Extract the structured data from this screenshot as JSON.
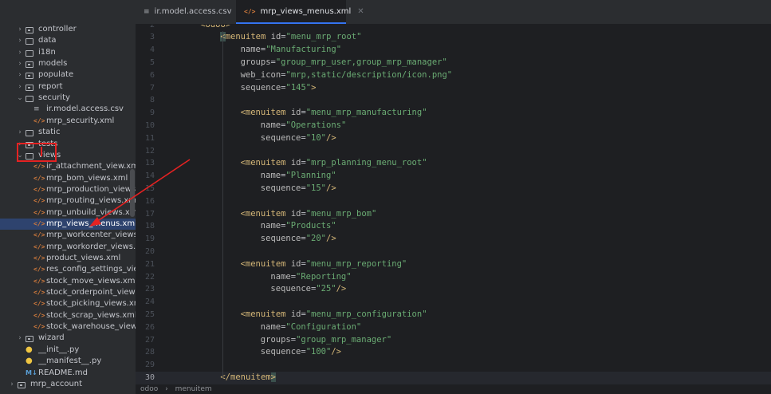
{
  "tabs": [
    {
      "label": "ir.model.access.csv",
      "icon": "csv-file-icon",
      "active": false
    },
    {
      "label": "mrp_views_menus.xml",
      "icon": "xml-file-icon",
      "active": true
    }
  ],
  "tree": [
    {
      "label": "controller",
      "type": "pkg",
      "depth": 1,
      "expanded": false
    },
    {
      "label": "data",
      "type": "folder",
      "depth": 1,
      "expanded": false
    },
    {
      "label": "i18n",
      "type": "folder",
      "depth": 1,
      "expanded": false
    },
    {
      "label": "models",
      "type": "pkg",
      "depth": 1,
      "expanded": false
    },
    {
      "label": "populate",
      "type": "pkg",
      "depth": 1,
      "expanded": false
    },
    {
      "label": "report",
      "type": "pkg",
      "depth": 1,
      "expanded": false
    },
    {
      "label": "security",
      "type": "folder",
      "depth": 1,
      "expanded": true
    },
    {
      "label": "ir.model.access.csv",
      "type": "csv",
      "depth": 2
    },
    {
      "label": "mrp_security.xml",
      "type": "xml",
      "depth": 2
    },
    {
      "label": "static",
      "type": "folder",
      "depth": 1,
      "expanded": false
    },
    {
      "label": "tests",
      "type": "pkg",
      "depth": 1,
      "expanded": false
    },
    {
      "label": "views",
      "type": "folder",
      "depth": 1,
      "expanded": true
    },
    {
      "label": "ir_attachment_view.xml",
      "type": "xml",
      "depth": 2
    },
    {
      "label": "mrp_bom_views.xml",
      "type": "xml",
      "depth": 2
    },
    {
      "label": "mrp_production_views.xml",
      "type": "xml",
      "depth": 2
    },
    {
      "label": "mrp_routing_views.xml",
      "type": "xml",
      "depth": 2
    },
    {
      "label": "mrp_unbuild_views.xml",
      "type": "xml",
      "depth": 2
    },
    {
      "label": "mrp_views_menus.xml",
      "type": "xml",
      "depth": 2,
      "selected": true
    },
    {
      "label": "mrp_workcenter_views.xml",
      "type": "xml",
      "depth": 2
    },
    {
      "label": "mrp_workorder_views.xml",
      "type": "xml",
      "depth": 2
    },
    {
      "label": "product_views.xml",
      "type": "xml",
      "depth": 2
    },
    {
      "label": "res_config_settings_views.xml",
      "type": "xml",
      "depth": 2
    },
    {
      "label": "stock_move_views.xml",
      "type": "xml",
      "depth": 2
    },
    {
      "label": "stock_orderpoint_views.xml",
      "type": "xml",
      "depth": 2
    },
    {
      "label": "stock_picking_views.xml",
      "type": "xml",
      "depth": 2
    },
    {
      "label": "stock_scrap_views.xml",
      "type": "xml",
      "depth": 2
    },
    {
      "label": "stock_warehouse_views.xml",
      "type": "xml",
      "depth": 2
    },
    {
      "label": "wizard",
      "type": "pkg",
      "depth": 1,
      "expanded": false
    },
    {
      "label": "__init__.py",
      "type": "py",
      "depth": 1
    },
    {
      "label": "__manifest__.py",
      "type": "py",
      "depth": 1
    },
    {
      "label": "README.md",
      "type": "md",
      "depth": 1
    },
    {
      "label": "mrp_account",
      "type": "pkg",
      "depth": 0,
      "expanded": false
    }
  ],
  "editor": {
    "current_line": 30,
    "lines": [
      {
        "n": 2,
        "tokens": [
          [
            "tag",
            "<odoo>"
          ]
        ],
        "indent": 4
      },
      {
        "n": 3,
        "tokens": [
          [
            "tag-hl",
            "<"
          ],
          [
            "tag",
            "menuitem "
          ],
          [
            "attr",
            "id"
          ],
          [
            "eq",
            "="
          ],
          [
            "str",
            "\"menu_mrp_root\""
          ]
        ],
        "indent": 8
      },
      {
        "n": 4,
        "tokens": [
          [
            "attr",
            "name"
          ],
          [
            "eq",
            "="
          ],
          [
            "str",
            "\"Manufacturing\""
          ]
        ],
        "indent": 12
      },
      {
        "n": 5,
        "tokens": [
          [
            "attr",
            "groups"
          ],
          [
            "eq",
            "="
          ],
          [
            "str",
            "\"group_mrp_user,group_mrp_manager\""
          ]
        ],
        "indent": 12
      },
      {
        "n": 6,
        "tokens": [
          [
            "attr",
            "web_icon"
          ],
          [
            "eq",
            "="
          ],
          [
            "str",
            "\"mrp,static/description/icon.png\""
          ]
        ],
        "indent": 12
      },
      {
        "n": 7,
        "tokens": [
          [
            "attr",
            "sequence"
          ],
          [
            "eq",
            "="
          ],
          [
            "str",
            "\"145\""
          ],
          [
            "punct",
            ">"
          ]
        ],
        "indent": 12
      },
      {
        "n": 8,
        "tokens": [],
        "indent": 0
      },
      {
        "n": 9,
        "tokens": [
          [
            "tag",
            "<menuitem "
          ],
          [
            "attr",
            "id"
          ],
          [
            "eq",
            "="
          ],
          [
            "str",
            "\"menu_mrp_manufacturing\""
          ]
        ],
        "indent": 12
      },
      {
        "n": 10,
        "tokens": [
          [
            "attr",
            "name"
          ],
          [
            "eq",
            "="
          ],
          [
            "str",
            "\"Operations\""
          ]
        ],
        "indent": 16
      },
      {
        "n": 11,
        "tokens": [
          [
            "attr",
            "sequence"
          ],
          [
            "eq",
            "="
          ],
          [
            "str",
            "\"10\""
          ],
          [
            "punct",
            "/>"
          ]
        ],
        "indent": 16
      },
      {
        "n": 12,
        "tokens": [],
        "indent": 0
      },
      {
        "n": 13,
        "tokens": [
          [
            "tag",
            "<menuitem "
          ],
          [
            "attr",
            "id"
          ],
          [
            "eq",
            "="
          ],
          [
            "str",
            "\"mrp_planning_menu_root\""
          ]
        ],
        "indent": 12
      },
      {
        "n": 14,
        "tokens": [
          [
            "attr",
            "name"
          ],
          [
            "eq",
            "="
          ],
          [
            "str",
            "\"Planning\""
          ]
        ],
        "indent": 16
      },
      {
        "n": 15,
        "tokens": [
          [
            "attr",
            "sequence"
          ],
          [
            "eq",
            "="
          ],
          [
            "str",
            "\"15\""
          ],
          [
            "punct",
            "/>"
          ]
        ],
        "indent": 16
      },
      {
        "n": 16,
        "tokens": [],
        "indent": 0
      },
      {
        "n": 17,
        "tokens": [
          [
            "tag",
            "<menuitem "
          ],
          [
            "attr",
            "id"
          ],
          [
            "eq",
            "="
          ],
          [
            "str",
            "\"menu_mrp_bom\""
          ]
        ],
        "indent": 12
      },
      {
        "n": 18,
        "tokens": [
          [
            "attr",
            "name"
          ],
          [
            "eq",
            "="
          ],
          [
            "str",
            "\"Products\""
          ]
        ],
        "indent": 16
      },
      {
        "n": 19,
        "tokens": [
          [
            "attr",
            "sequence"
          ],
          [
            "eq",
            "="
          ],
          [
            "str",
            "\"20\""
          ],
          [
            "punct",
            "/>"
          ]
        ],
        "indent": 16
      },
      {
        "n": 20,
        "tokens": [],
        "indent": 0
      },
      {
        "n": 21,
        "tokens": [
          [
            "tag",
            "<menuitem "
          ],
          [
            "attr",
            "id"
          ],
          [
            "eq",
            "="
          ],
          [
            "str",
            "\"menu_mrp_reporting\""
          ]
        ],
        "indent": 12
      },
      {
        "n": 22,
        "tokens": [
          [
            "attr",
            "name"
          ],
          [
            "eq",
            "="
          ],
          [
            "str",
            "\"Reporting\""
          ]
        ],
        "indent": 18
      },
      {
        "n": 23,
        "tokens": [
          [
            "attr",
            "sequence"
          ],
          [
            "eq",
            "="
          ],
          [
            "str",
            "\"25\""
          ],
          [
            "punct",
            "/>"
          ]
        ],
        "indent": 18
      },
      {
        "n": 24,
        "tokens": [],
        "indent": 0
      },
      {
        "n": 25,
        "tokens": [
          [
            "tag",
            "<menuitem "
          ],
          [
            "attr",
            "id"
          ],
          [
            "eq",
            "="
          ],
          [
            "str",
            "\"menu_mrp_configuration\""
          ]
        ],
        "indent": 12
      },
      {
        "n": 26,
        "tokens": [
          [
            "attr",
            "name"
          ],
          [
            "eq",
            "="
          ],
          [
            "str",
            "\"Configuration\""
          ]
        ],
        "indent": 16
      },
      {
        "n": 27,
        "tokens": [
          [
            "attr",
            "groups"
          ],
          [
            "eq",
            "="
          ],
          [
            "str",
            "\"group_mrp_manager\""
          ]
        ],
        "indent": 16
      },
      {
        "n": 28,
        "tokens": [
          [
            "attr",
            "sequence"
          ],
          [
            "eq",
            "="
          ],
          [
            "str",
            "\"100\""
          ],
          [
            "punct",
            "/>"
          ]
        ],
        "indent": 16
      },
      {
        "n": 29,
        "tokens": [],
        "indent": 0
      },
      {
        "n": 30,
        "tokens": [
          [
            "tag",
            "</menuitem"
          ],
          [
            "tag-hl",
            ">"
          ]
        ],
        "indent": 8
      }
    ]
  },
  "breadcrumb": [
    "odoo",
    "menuitem"
  ],
  "colors": {
    "annotation": "#e52222",
    "selection": "#2e436e",
    "accent": "#3574f0"
  }
}
